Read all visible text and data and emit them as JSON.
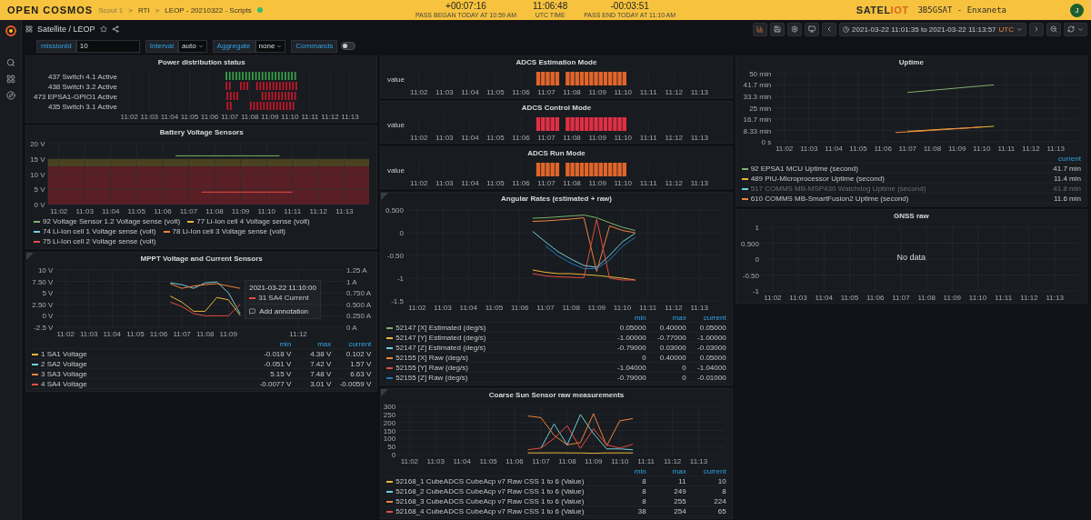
{
  "top_bar": {
    "logo": "OPEN COSMOS",
    "breadcrumb": [
      {
        "label": "Scout 1",
        "muted": true
      },
      {
        "label": "RTI",
        "muted": false
      },
      {
        "label": "LEOP - 20210322 - Scripts",
        "muted": false
      }
    ],
    "separator": ">",
    "timers": [
      {
        "value": "+00:07:16",
        "caption": "PASS BEGAN TODAY AT 10:59 AM"
      },
      {
        "value": "11:06:48",
        "caption": "UTC TIME"
      },
      {
        "value": "-00:03:51",
        "caption": "PASS END TODAY AT 11:10 AM"
      }
    ],
    "brand": {
      "main": "SATEL",
      "accent": "IOT"
    },
    "mission": "3B5GSAT - Enxaneta",
    "avatar": "J"
  },
  "dashboard": {
    "title": "Satellite / LEOP"
  },
  "time_range": {
    "text": "2021-03-22 11:01:35 to 2021-03-22 11:13:57",
    "timezone": "UTC"
  },
  "variables": [
    {
      "kind": "text",
      "label": "missionId",
      "value": "10"
    },
    {
      "kind": "select",
      "label": "Interval",
      "value": "auto"
    },
    {
      "kind": "select",
      "label": "Aggregate",
      "value": "none"
    },
    {
      "kind": "toggle",
      "label": "Commands",
      "on": false
    }
  ],
  "columns": [
    {
      "panels": [
        {
          "kind": "state",
          "title": "Power distribution status",
          "xticks": [
            "11:02",
            "11:03",
            "11:04",
            "11:05",
            "11:06",
            "11:07",
            "11:08",
            "11:09",
            "11:10",
            "11:11",
            "11:12",
            "11:13"
          ],
          "rows": [
            {
              "label": "437 Switch 4.1 Active",
              "color": "#37a04a"
            },
            {
              "label": "438 Switch 3.2 Active",
              "color": "#c4162a"
            },
            {
              "label": "473 EPSA1-GPIO1 Active",
              "color": "#c4162a"
            },
            {
              "label": "435 Switch 3.1 Active",
              "color": "#c4162a"
            }
          ]
        },
        {
          "kind": "graph",
          "title": "Battery Voltage Sensors",
          "chart_data": {
            "type": "line",
            "grid": true,
            "categories": [
              "11:02",
              null,
              "11:03",
              null,
              "11:04",
              null,
              "11:05",
              null,
              "11:06",
              null,
              "11:07",
              null,
              "11:08",
              null,
              "11:09",
              null,
              "11:10",
              null,
              "11:11",
              null,
              "11:12",
              null,
              "11:13"
            ],
            "ylim": [
              0,
              20
            ],
            "yticks": [
              {
                "value": 0,
                "label": "0 V"
              },
              {
                "value": 5,
                "label": "5 V"
              },
              {
                "value": 10,
                "label": "10 V"
              },
              {
                "value": 15,
                "label": "15 V"
              },
              {
                "value": 20,
                "label": "20 V"
              }
            ],
            "series": [
              {
                "name": "92 Voltage Sensor 1.2 Voltage sense (volt)",
                "color": "#7eb26d",
                "values": [
                  null,
                  null,
                  null,
                  null,
                  null,
                  null,
                  null,
                  null,
                  null,
                  16,
                  16,
                  16,
                  16,
                  16,
                  16,
                  16,
                  16,
                  16,
                  null,
                  null,
                  null,
                  null,
                  null
                ]
              },
              {
                "name": "77 Li-Ion cell 4 Voltage sense (volt)",
                "color": "#eab839",
                "values": [
                  null,
                  null,
                  null,
                  null,
                  null,
                  null,
                  null,
                  null,
                  null,
                  null,
                  null,
                  null,
                  null,
                  null,
                  null,
                  null,
                  null,
                  null,
                  null,
                  null,
                  null,
                  null,
                  null
                ]
              },
              {
                "name": "74 Li-Ion cell 1 Voltage sense (volt)",
                "color": "#6ed0e0",
                "values": [
                  null,
                  null,
                  null,
                  null,
                  null,
                  null,
                  null,
                  null,
                  null,
                  null,
                  null,
                  null,
                  null,
                  null,
                  null,
                  null,
                  null,
                  null,
                  null,
                  null,
                  null,
                  null,
                  null
                ]
              },
              {
                "name": "78 Li-Ion cell 3 Voltage sense (volt)",
                "color": "#ef843c",
                "values": [
                  null,
                  null,
                  null,
                  null,
                  null,
                  null,
                  null,
                  null,
                  null,
                  null,
                  null,
                  null,
                  null,
                  null,
                  null,
                  null,
                  null,
                  null,
                  null,
                  null,
                  null,
                  null,
                  null
                ]
              },
              {
                "name": "75 Li-Ion cell 2 Voltage sense (volt)",
                "color": "#e24d42",
                "values": [
                  null,
                  null,
                  null,
                  null,
                  null,
                  null,
                  null,
                  null,
                  null,
                  null,
                  null,
                  4.1,
                  4.1,
                  4.1,
                  4.1,
                  4.1,
                  4.1,
                  4.1,
                  4.1,
                  null,
                  null,
                  null,
                  null
                ]
              }
            ],
            "bands": [
              {
                "axis": "y",
                "from": 12.5,
                "to": 15,
                "color": "#4a4220"
              },
              {
                "axis": "y",
                "from": 0,
                "to": 12.5,
                "color": "#5a1f24"
              }
            ]
          }
        },
        {
          "kind": "graph",
          "title": "MPPT Voltage and Current Sensors",
          "has_description": true,
          "right_ticks": [
            "1.25 A",
            "1 A",
            "0.750 A",
            "0.500 A",
            "0.250 A",
            "0 A"
          ],
          "tooltip": {
            "time": "2021-03-22 11:10:00",
            "series": "31 SA4 Current",
            "color": "#e24d42",
            "action": "Add annotation"
          },
          "chart_data": {
            "type": "line",
            "grid": true,
            "categories": [
              "11:02",
              null,
              "11:03",
              null,
              "11:04",
              null,
              "11:05",
              null,
              "11:06",
              null,
              "11:07",
              null,
              "11:08",
              null,
              "11:09",
              null,
              null,
              null,
              null,
              null,
              "11:12",
              null,
              null
            ],
            "ylim": [
              -2.5,
              10
            ],
            "yticks": [
              {
                "value": -2.5,
                "label": "-2.5 V"
              },
              {
                "value": 0,
                "label": "0 V"
              },
              {
                "value": 2.5,
                "label": "2.50 V"
              },
              {
                "value": 5,
                "label": "5 V"
              },
              {
                "value": 7.5,
                "label": "7.50 V"
              },
              {
                "value": 10,
                "label": "10 V"
              }
            ],
            "series": [
              {
                "name": "1 SA1 Voltage",
                "color": "#eab839",
                "values": [
                  null,
                  null,
                  null,
                  null,
                  null,
                  null,
                  null,
                  null,
                  null,
                  4.3,
                  3,
                  1,
                  1,
                  4,
                  3.5,
                  0.1,
                  null,
                  null,
                  null,
                  null,
                  null,
                  null,
                  null
                ]
              },
              {
                "name": "2 SA2 Voltage",
                "color": "#6ed0e0",
                "values": [
                  null,
                  null,
                  null,
                  null,
                  null,
                  null,
                  null,
                  null,
                  null,
                  7.2,
                  6.8,
                  6,
                  7.2,
                  7.4,
                  5,
                  0.5,
                  null,
                  null,
                  null,
                  null,
                  null,
                  null,
                  null
                ]
              },
              {
                "name": "3 SA3 Voltage",
                "color": "#ef843c",
                "values": [
                  null,
                  null,
                  null,
                  null,
                  null,
                  null,
                  null,
                  null,
                  null,
                  7,
                  6,
                  6.5,
                  6.8,
                  7,
                  6.5,
                  6,
                  null,
                  null,
                  null,
                  null,
                  null,
                  null,
                  null
                ]
              },
              {
                "name": "4 SA4 Voltage",
                "color": "#e24d42",
                "values": [
                  null,
                  null,
                  null,
                  null,
                  null,
                  null,
                  null,
                  null,
                  null,
                  3,
                  2,
                  0.5,
                  0,
                  0,
                  0,
                  2.5,
                  null,
                  null,
                  null,
                  null,
                  null,
                  null,
                  null
                ]
              }
            ]
          },
          "legend": {
            "columns": [
              "min",
              "max",
              "current"
            ],
            "items": [
              {
                "values": [
                  "-0.018 V",
                  "4.38 V",
                  "0.102 V"
                ],
                "hidden": false
              },
              {
                "values": [
                  "-0.051 V",
                  "7.42 V",
                  "1.57 V"
                ],
                "hidden": false
              },
              {
                "values": [
                  "5.15 V",
                  "7.48 V",
                  "6.63 V"
                ],
                "hidden": false
              },
              {
                "values": [
                  "-0.0077 V",
                  "3.01 V",
                  "-0.0059 V"
                ],
                "hidden": false
              }
            ]
          }
        }
      ]
    },
    {
      "panels": [
        {
          "kind": "state",
          "title": "ADCS Estimation Mode",
          "xticks": [
            "11:02",
            "11:03",
            "11:04",
            "11:05",
            "11:06",
            "11:07",
            "11:08",
            "11:09",
            "11:10",
            "11:11",
            "11:12",
            "11:13"
          ],
          "rows": [
            {
              "label": "value",
              "color": "#e0652b"
            }
          ]
        },
        {
          "kind": "state",
          "title": "ADCS Control Mode",
          "xticks": [
            "11:02",
            "11:03",
            "11:04",
            "11:05",
            "11:06",
            "11:07",
            "11:08",
            "11:09",
            "11:10",
            "11:11",
            "11:12",
            "11:13"
          ],
          "rows": [
            {
              "label": "value",
              "color": "#e02f44"
            }
          ]
        },
        {
          "kind": "state",
          "title": "ADCS Run Mode",
          "xticks": [
            "11:02",
            "11:03",
            "11:04",
            "11:05",
            "11:06",
            "11:07",
            "11:08",
            "11:09",
            "11:10",
            "11:11",
            "11:12",
            "11:13"
          ],
          "rows": [
            {
              "label": "value",
              "color": "#e0652b"
            }
          ]
        },
        {
          "kind": "graph",
          "title": "Angular Rates (estimated + raw)",
          "has_description": true,
          "chart_data": {
            "type": "line",
            "grid": true,
            "categories": [
              "11:02",
              null,
              "11:03",
              null,
              "11:04",
              null,
              "11:05",
              null,
              "11:06",
              null,
              "11:07",
              null,
              "11:08",
              null,
              "11:09",
              null,
              "11:10",
              null,
              "11:11",
              null,
              "11:12",
              null,
              "11:13"
            ],
            "ylim": [
              -1.5,
              0.5
            ],
            "yticks": [
              {
                "value": -1.5,
                "label": "-1.5"
              },
              {
                "value": -1,
                "label": "-1"
              },
              {
                "value": -0.5,
                "label": "-0.50"
              },
              {
                "value": 0,
                "label": "0"
              },
              {
                "value": 0.5,
                "label": "0.500"
              }
            ],
            "series": [
              {
                "name": "52147 [X] Estimated (deg/s)",
                "color": "#7eb26d",
                "values": [
                  null,
                  null,
                  null,
                  null,
                  null,
                  null,
                  null,
                  null,
                  null,
                  0.32,
                  0.33,
                  0.35,
                  0.37,
                  0.39,
                  0.33,
                  0.22,
                  0.12,
                  0.05,
                  null,
                  null,
                  null,
                  null,
                  null
                ]
              },
              {
                "name": "52147 [Y] Estimated (deg/s)",
                "color": "#eab839",
                "values": [
                  null,
                  null,
                  null,
                  null,
                  null,
                  null,
                  null,
                  null,
                  null,
                  -0.82,
                  -0.87,
                  -0.9,
                  -0.9,
                  -0.92,
                  -0.94,
                  -0.97,
                  -1.0,
                  -1.04,
                  null,
                  null,
                  null,
                  null,
                  null
                ]
              },
              {
                "name": "52147 [Z] Estimated (deg/s)",
                "color": "#6ed0e0",
                "values": [
                  null,
                  null,
                  null,
                  null,
                  null,
                  null,
                  null,
                  null,
                  null,
                  0.03,
                  -0.2,
                  -0.42,
                  -0.58,
                  -0.72,
                  -0.76,
                  -0.5,
                  -0.2,
                  -0.01,
                  null,
                  null,
                  null,
                  null,
                  null
                ]
              },
              {
                "name": "52155 [X] Raw (deg/s)",
                "color": "#ef843c",
                "values": [
                  null,
                  null,
                  null,
                  null,
                  null,
                  null,
                  null,
                  null,
                  null,
                  0.25,
                  0.26,
                  0.28,
                  0.3,
                  0.33,
                  -0.85,
                  0.15,
                  0.05,
                  0.0,
                  null,
                  null,
                  null,
                  null,
                  null
                ]
              },
              {
                "name": "52155 [Y] Raw (deg/s)",
                "color": "#e24d42",
                "values": [
                  null,
                  null,
                  null,
                  null,
                  null,
                  null,
                  null,
                  null,
                  null,
                  -0.9,
                  -0.95,
                  -0.97,
                  -0.98,
                  -0.99,
                  0.3,
                  -1.0,
                  -1.04,
                  -1.04,
                  null,
                  null,
                  null,
                  null,
                  null
                ]
              },
              {
                "name": "52155 [Z] Raw (deg/s)",
                "color": "#1f78c1",
                "values": [
                  null,
                  null,
                  null,
                  null,
                  null,
                  null,
                  null,
                  null,
                  null,
                  null,
                  -0.29,
                  -0.51,
                  -0.67,
                  -0.79,
                  -0.79,
                  -0.6,
                  -0.3,
                  -0.1,
                  null,
                  null,
                  null,
                  null,
                  null
                ]
              }
            ]
          },
          "legend": {
            "columns": [
              "min",
              "max",
              "current"
            ],
            "items": [
              {
                "values": [
                  "0.05000",
                  "0.40000",
                  "0.05000"
                ],
                "hidden": false
              },
              {
                "values": [
                  "-1.00000",
                  "-0.77000",
                  "-1.00000"
                ],
                "hidden": false
              },
              {
                "values": [
                  "-0.79000",
                  "0.03000",
                  "-0.03000"
                ],
                "hidden": false
              },
              {
                "values": [
                  "0",
                  "0.40000",
                  "0.05000"
                ],
                "hidden": false
              },
              {
                "values": [
                  "-1.04000",
                  "0",
                  "-1.04000"
                ],
                "hidden": false
              },
              {
                "values": [
                  "-0.79000",
                  "0",
                  "-0.01000"
                ],
                "hidden": false
              }
            ]
          }
        },
        {
          "kind": "graph",
          "title": "Coarse Sun Sensor raw measurements",
          "has_description": true,
          "chart_data": {
            "type": "line",
            "grid": true,
            "categories": [
              "11:02",
              null,
              "11:03",
              null,
              "11:04",
              null,
              "11:05",
              null,
              "11:06",
              null,
              "11:07",
              null,
              "11:08",
              null,
              "11:09",
              null,
              "11:10",
              null,
              "11:11",
              null,
              "11:12",
              null,
              "11:13"
            ],
            "ylim": [
              0,
              300
            ],
            "yticks": [
              0,
              50,
              100,
              150,
              200,
              250,
              300
            ],
            "series": [
              {
                "name": "52168_1 CubeADCS CubeAcp v7 Raw CSS 1 to 6 (Value)",
                "color": "#eab839",
                "values": [
                  null,
                  null,
                  null,
                  null,
                  null,
                  null,
                  null,
                  null,
                  null,
                  10,
                  10,
                  11,
                  10,
                  10,
                  8,
                  10,
                  10,
                  10,
                  null,
                  null,
                  null,
                  null,
                  null
                ]
              },
              {
                "name": "52168_2 CubeADCS CubeAcp v7 Raw CSS 1 to 6 (Value)",
                "color": "#6ed0e0",
                "values": [
                  null,
                  null,
                  null,
                  null,
                  null,
                  null,
                  null,
                  null,
                  null,
                  null,
                  40,
                  190,
                  60,
                  249,
                  130,
                  35,
                  35,
                  30,
                  null,
                  null,
                  null,
                  null,
                  null
                ]
              },
              {
                "name": "52168_3 CubeADCS CubeAcp v7 Raw CSS 1 to 6 (Value)",
                "color": "#ef843c",
                "values": [
                  null,
                  null,
                  null,
                  null,
                  null,
                  null,
                  null,
                  null,
                  null,
                  240,
                  230,
                  120,
                  60,
                  75,
                  255,
                  55,
                  210,
                  224,
                  null,
                  null,
                  null,
                  null,
                  null
                ]
              },
              {
                "name": "52168_4 CubeADCS CubeAcp v7 Raw CSS 1 to 6 (Value)",
                "color": "#e24d42",
                "values": [
                  null,
                  null,
                  null,
                  null,
                  null,
                  null,
                  null,
                  null,
                  null,
                  30,
                  40,
                  100,
                  180,
                  38,
                  160,
                  60,
                  40,
                  65,
                  null,
                  null,
                  null,
                  null,
                  null
                ]
              }
            ]
          },
          "legend": {
            "columns": [
              "min",
              "max",
              "current"
            ],
            "items": [
              {
                "values": [
                  "8",
                  "11",
                  "10"
                ],
                "hidden": false
              },
              {
                "values": [
                  "8",
                  "249",
                  "8"
                ],
                "hidden": false
              },
              {
                "values": [
                  "8",
                  "255",
                  "224"
                ],
                "hidden": false
              },
              {
                "values": [
                  "38",
                  "254",
                  "65"
                ],
                "hidden": false
              }
            ]
          }
        }
      ]
    },
    {
      "panels": [
        {
          "kind": "graph",
          "title": "Uptime",
          "chart_data": {
            "type": "line",
            "grid": true,
            "categories": [
              "11:02",
              null,
              "11:03",
              null,
              "11:04",
              null,
              "11:05",
              null,
              "11:06",
              null,
              "11:07",
              null,
              "11:08",
              null,
              "11:09",
              null,
              "11:10",
              null,
              "11:11",
              null,
              "11:12",
              null,
              "11:13"
            ],
            "ylim": [
              0,
              50
            ],
            "yticks": [
              {
                "value": 0,
                "label": "0 s"
              },
              {
                "value": 8.33,
                "label": "8.33 min"
              },
              {
                "value": 16.7,
                "label": "16.7 min"
              },
              {
                "value": 25,
                "label": "25 min"
              },
              {
                "value": 33.3,
                "label": "33.3 min"
              },
              {
                "value": 41.7,
                "label": "41.7 min"
              },
              {
                "value": 50,
                "label": "50 min"
              }
            ],
            "series": [
              {
                "name": "92 EPSA1 MCU Uptime (second)",
                "color": "#7eb26d",
                "values": [
                  null,
                  null,
                  null,
                  null,
                  null,
                  null,
                  null,
                  null,
                  null,
                  null,
                  36.2,
                  37,
                  37.8,
                  38.6,
                  39.4,
                  40.2,
                  41,
                  41.7,
                  null,
                  null,
                  null,
                  null,
                  null
                ]
              },
              {
                "name": "489 PIU-Microprocessor Uptime (second)",
                "color": "#eab839",
                "values": [
                  null,
                  null,
                  null,
                  null,
                  null,
                  null,
                  null,
                  null,
                  null,
                  null,
                  7.7,
                  8.2,
                  8.8,
                  9.3,
                  9.8,
                  10.3,
                  10.9,
                  11.4,
                  null,
                  null,
                  null,
                  null,
                  null
                ]
              },
              {
                "name": "517 COMMS MB-MSP430 Watchdog Uptime (second)",
                "color": "#6ed0e0",
                "values": [
                  null,
                  null,
                  null,
                  null,
                  null,
                  null,
                  null,
                  null,
                  null,
                  null,
                  null,
                  null,
                  null,
                  null,
                  null,
                  null,
                  null,
                  null,
                  null,
                  null,
                  null,
                  null,
                  null
                ]
              },
              {
                "name": "610 COMMS MB-SmartFusion2 Uptime (second)",
                "color": "#ef843c",
                "values": [
                  null,
                  null,
                  null,
                  null,
                  null,
                  null,
                  null,
                  null,
                  null,
                  6.8,
                  7.3,
                  7.8,
                  8.4,
                  9,
                  9.6,
                  10.2,
                  10.9,
                  null,
                  null,
                  null,
                  null,
                  null,
                  null
                ]
              }
            ]
          },
          "legend": {
            "columns": [
              "current"
            ],
            "items": [
              {
                "values": [
                  "41.7 min"
                ],
                "hidden": false
              },
              {
                "values": [
                  "11.4 min"
                ],
                "hidden": false
              },
              {
                "values": [
                  "41.8 min"
                ],
                "hidden": true
              },
              {
                "values": [
                  "11.6 min"
                ],
                "hidden": false
              }
            ]
          }
        },
        {
          "kind": "graph",
          "title": "GNSS raw",
          "no_data": "No data",
          "chart_data": {
            "type": "line",
            "grid": true,
            "categories": [
              "11:02",
              null,
              "11:03",
              null,
              "11:04",
              null,
              "11:05",
              null,
              "11:06",
              null,
              "11:07",
              null,
              "11:08",
              null,
              "11:09",
              null,
              "11:10",
              null,
              "11:11",
              null,
              "11:12",
              null,
              "11:13"
            ],
            "ylim": [
              -1,
              1
            ],
            "yticks": [
              {
                "value": -1,
                "label": "-1"
              },
              {
                "value": -0.5,
                "label": "-0.50"
              },
              {
                "value": 0,
                "label": "0"
              },
              {
                "value": 0.5,
                "label": "0.500"
              },
              {
                "value": 1,
                "label": "1"
              }
            ]
          }
        }
      ]
    }
  ]
}
